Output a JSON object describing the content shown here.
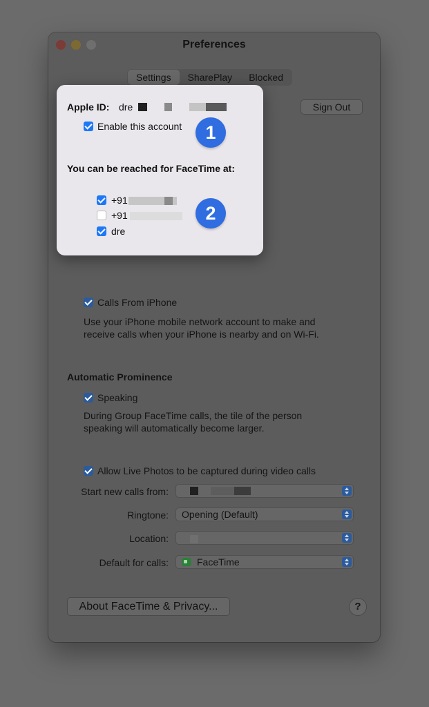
{
  "window": {
    "title": "Preferences"
  },
  "tabs": [
    "Settings",
    "SharePlay",
    "Blocked"
  ],
  "account": {
    "apple_id_label": "Apple ID:",
    "apple_id_visible": "dre",
    "sign_out": "Sign Out",
    "enable_label": "Enable this account",
    "enable_checked": true
  },
  "reach": {
    "heading": "You can be reached for FaceTime at:",
    "items": [
      {
        "text": "+91",
        "checked": true
      },
      {
        "text": "+91",
        "checked": false
      },
      {
        "text": "dre",
        "checked": true
      }
    ]
  },
  "annotations": [
    "1",
    "2"
  ],
  "calls_from_iphone": {
    "label": "Calls From iPhone",
    "desc_line1": "Use your iPhone mobile network account to make and",
    "desc_line2": "receive calls when your iPhone is nearby and on Wi-Fi."
  },
  "prominence": {
    "heading": "Automatic Prominence",
    "speaking_label": "Speaking",
    "desc_line1": "During Group FaceTime calls, the tile of the person",
    "desc_line2": "speaking will automatically become larger."
  },
  "live_photos": {
    "label": "Allow Live Photos to be captured during video calls"
  },
  "settings": {
    "start_calls_label": "Start new calls from:",
    "ringtone_label": "Ringtone:",
    "ringtone_value": "Opening (Default)",
    "location_label": "Location:",
    "default_calls_label": "Default for calls:",
    "default_calls_value": "FaceTime"
  },
  "about_button": "About FaceTime & Privacy...",
  "help_button": "?",
  "icons": {
    "checkbox": "checkmark-icon",
    "stepper": "up-down-chevron-icon",
    "facetime": "facetime-app-icon"
  },
  "colors": {
    "accent": "#1d78f5",
    "badge": "#2f6de0",
    "popover_bg": "#eae7ec"
  }
}
